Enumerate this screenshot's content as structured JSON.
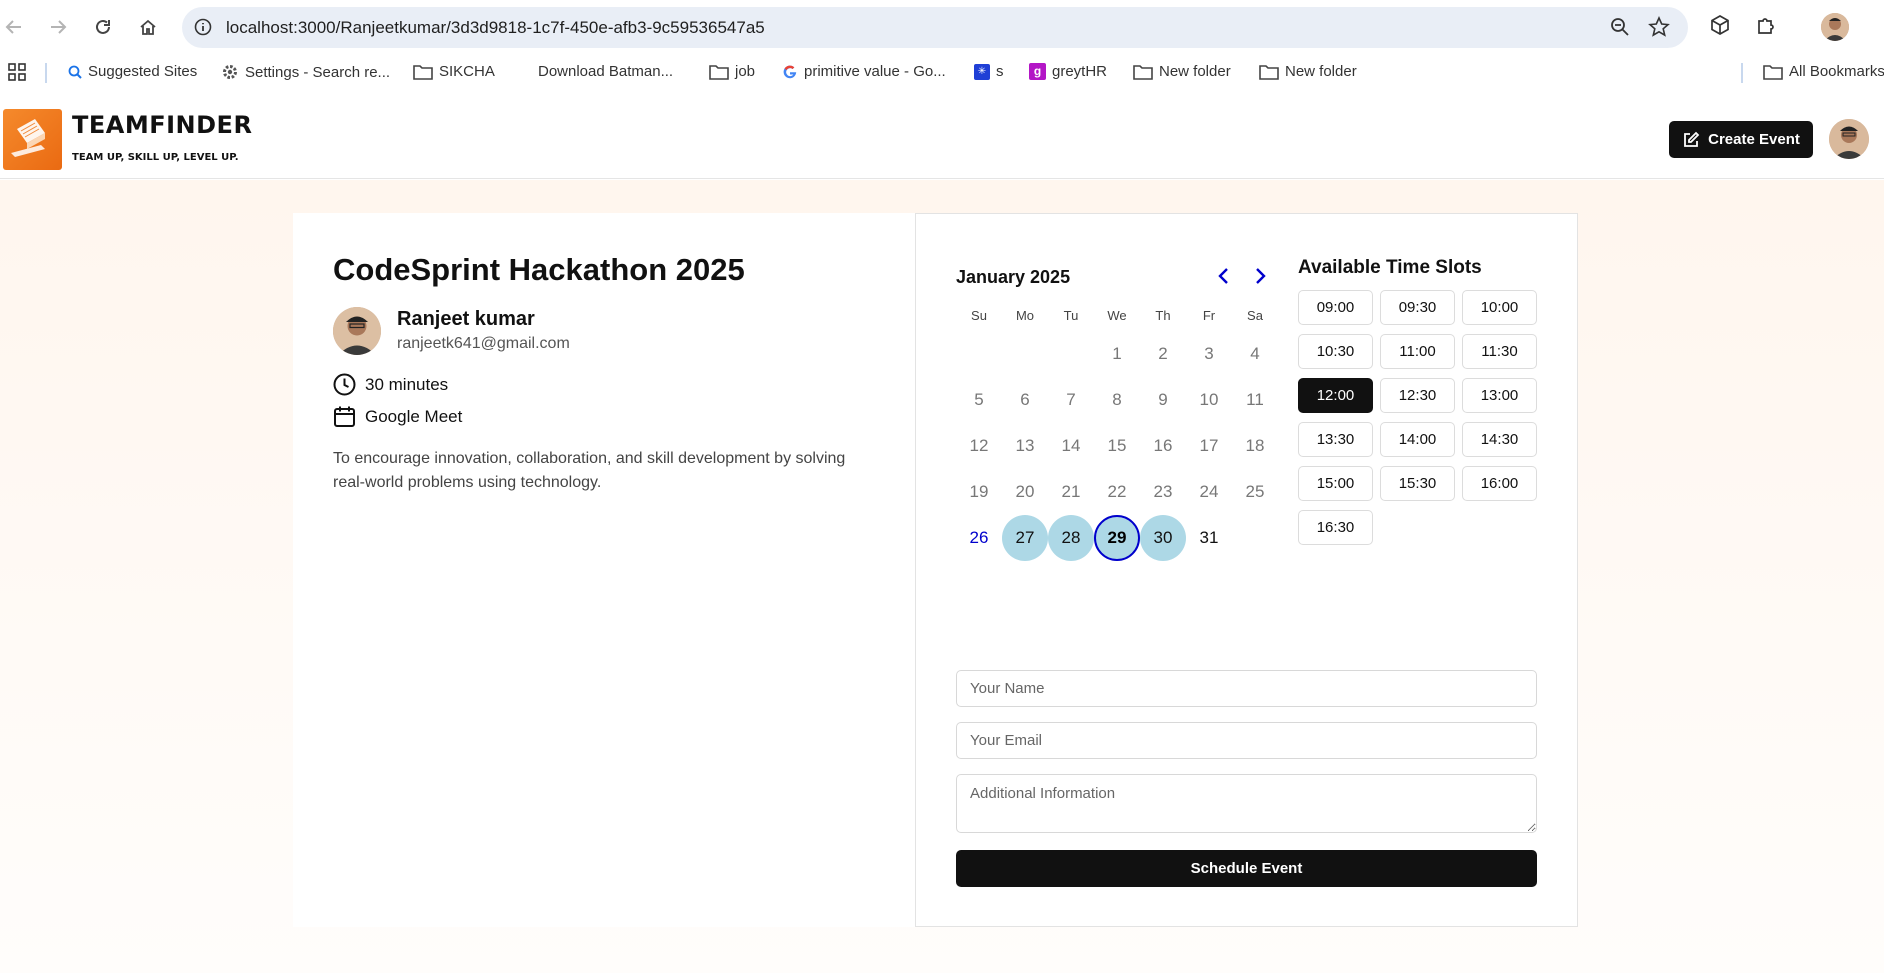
{
  "browser": {
    "url": "localhost:3000/Ranjeetkumar/3d3d9818-1c7f-450e-afb3-9c59536547a5",
    "bookmarks": [
      {
        "label": "Suggested Sites",
        "icon": "search-icon"
      },
      {
        "label": "Settings - Search re...",
        "icon": "gear-icon"
      },
      {
        "label": "SIKCHA",
        "icon": "folder-icon"
      },
      {
        "label": "Download Batman...",
        "icon": ""
      },
      {
        "label": "job",
        "icon": "folder-icon"
      },
      {
        "label": "primitive value - Go...",
        "icon": "google-icon"
      },
      {
        "label": "s",
        "icon": "app-icon"
      },
      {
        "label": "greytHR",
        "icon": "greythr-icon"
      },
      {
        "label": "New folder",
        "icon": "folder-icon"
      },
      {
        "label": "New folder",
        "icon": "folder-icon"
      }
    ],
    "all_bookmarks": "All Bookmarks"
  },
  "header": {
    "logo_title": "TEAMFINDER",
    "logo_sub": "TEAM UP, SKILL UP, LEVEL UP.",
    "create_label": "Create Event"
  },
  "event": {
    "title": "CodeSprint Hackathon 2025",
    "host_name": "Ranjeet kumar",
    "host_email": "ranjeetk641@gmail.com",
    "duration": "30 minutes",
    "location": "Google Meet",
    "description": "To encourage innovation, collaboration, and skill development by solving real-world problems using technology."
  },
  "calendar": {
    "month": "January 2025",
    "weekdays": [
      "Su",
      "Mo",
      "Tu",
      "We",
      "Th",
      "Fr",
      "Sa"
    ],
    "first_weekday": 3,
    "days_in_month": 31,
    "today": 26,
    "available": [
      27,
      28,
      29,
      30
    ],
    "selected": 29,
    "dark": [
      31
    ]
  },
  "slots": {
    "title": "Available Time Slots",
    "times": [
      "09:00",
      "09:30",
      "10:00",
      "10:30",
      "11:00",
      "11:30",
      "12:00",
      "12:30",
      "13:00",
      "13:30",
      "14:00",
      "14:30",
      "15:00",
      "15:30",
      "16:00",
      "16:30"
    ],
    "selected": "12:00"
  },
  "form": {
    "name_placeholder": "Your Name",
    "email_placeholder": "Your Email",
    "info_placeholder": "Additional Information",
    "submit_label": "Schedule Event"
  },
  "colors": {
    "brand_orange": "#f07a1e",
    "available_day": "#add8e6",
    "selected_ring": "#0000cc",
    "primary_button": "#111111"
  }
}
